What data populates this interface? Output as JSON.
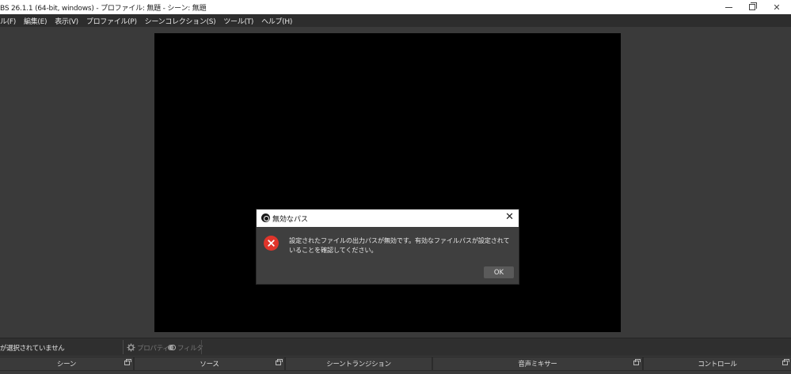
{
  "window": {
    "title": "BS 26.1.1 (64-bit, windows) - プロファイル: 無題 - シーン: 無題",
    "controls": [
      "minimize-icon",
      "maximize-icon",
      "close-icon"
    ]
  },
  "menu": {
    "items": [
      {
        "label": "ル(F)"
      },
      {
        "label": "編集(E)"
      },
      {
        "label": "表示(V)"
      },
      {
        "label": "プロファイル(P)"
      },
      {
        "label": "シーンコレクション(S)"
      },
      {
        "label": "ツール(T)"
      },
      {
        "label": "ヘルプ(H)"
      }
    ]
  },
  "dialog": {
    "title": "無効なパス",
    "message": "設定されたファイルの出力パスが無効です。有効なファイルパスが設定されていることを確認してください。",
    "ok_label": "OK",
    "close_symbol": "✕"
  },
  "source_toolbar": {
    "status": "が選択されていません",
    "properties_label": "プロパティ",
    "filters_label": "フィルタ"
  },
  "docks": [
    {
      "label": "シーン"
    },
    {
      "label": "ソース"
    },
    {
      "label": "シーントランジション"
    },
    {
      "label": "音声ミキサー"
    },
    {
      "label": "コントロール"
    }
  ],
  "colors": {
    "background": "#3a3a3a",
    "preview": "#000000",
    "error": "#e0352b",
    "menubar": "#2d2d2d"
  }
}
